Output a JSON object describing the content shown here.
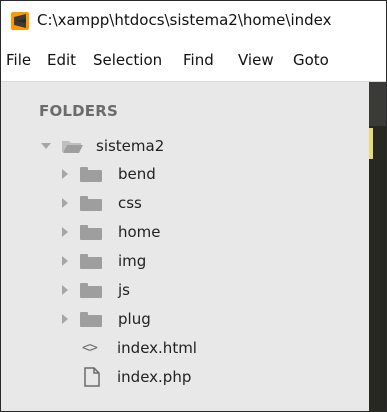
{
  "window": {
    "title": "C:\\xampp\\htdocs\\sistema2\\home\\index"
  },
  "menu": {
    "items": [
      "File",
      "Edit",
      "Selection",
      "Find",
      "View",
      "Goto"
    ]
  },
  "sidebar": {
    "header": "FOLDERS",
    "root": {
      "label": "sistema2"
    },
    "folders": [
      {
        "label": "bend"
      },
      {
        "label": "css"
      },
      {
        "label": "home"
      },
      {
        "label": "img"
      },
      {
        "label": "js"
      },
      {
        "label": "plug"
      }
    ],
    "files": [
      {
        "label": "index.html",
        "icon": "code-file-icon"
      },
      {
        "label": "index.php",
        "icon": "file-icon"
      }
    ]
  },
  "colors": {
    "sidebar_bg": "#e8e8e8",
    "editor_bg": "#272822",
    "accent": "#e6db74",
    "app_icon": "#ff9800"
  }
}
